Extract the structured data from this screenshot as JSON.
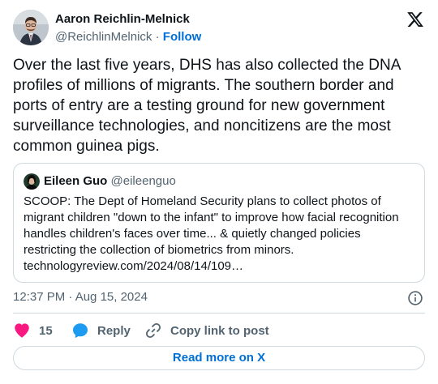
{
  "author": {
    "name": "Aaron Reichlin-Melnick",
    "handle": "@ReichlinMelnick",
    "separator": "·",
    "follow_label": "Follow"
  },
  "tweet": {
    "text": "Over the last five years, DHS has also collected the DNA profiles of millions of migrants. The southern border and ports of entry are a testing ground for new government surveillance technologies, and noncitizens are the most common guinea pigs."
  },
  "quote": {
    "name": "Eileen Guo",
    "handle": "@eileenguo",
    "text": "SCOOP: The Dept of Homeland Security plans to collect photos of migrant children \"down to the infant\" to improve how facial recognition handles children's faces over time... & quietly changed policies restricting the collection of biometrics from minors.",
    "link": "technologyreview.com/2024/08/14/109…"
  },
  "timestamp": "12:37 PM · Aug 15, 2024",
  "actions": {
    "like_count": "15",
    "reply_label": "Reply",
    "copy_label": "Copy link to post"
  },
  "read_more_label": "Read more on X",
  "icons": [
    "x-logo-icon",
    "info-icon",
    "heart-icon",
    "reply-bubble-icon",
    "link-icon"
  ],
  "colors": {
    "link_blue": "#006fd6",
    "like_red": "#f91880",
    "reply_blue": "#1d9bf0",
    "muted": "#536471",
    "border": "#cfd9de"
  }
}
